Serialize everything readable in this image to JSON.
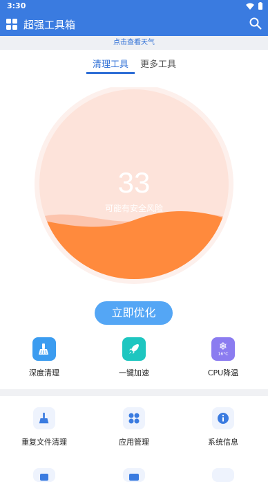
{
  "status_bar": {
    "time": "3:30"
  },
  "app_bar": {
    "title": "超强工具箱"
  },
  "weather_banner": "点击查看天气",
  "tabs": [
    {
      "label": "清理工具",
      "active": true
    },
    {
      "label": "更多工具",
      "active": false
    }
  ],
  "gauge": {
    "score": "33",
    "status": "可能有安全风险",
    "fill_level": 0.3
  },
  "optimize_button": "立即优化",
  "quick_actions": [
    {
      "label": "深度清理",
      "icon": "broom-icon",
      "color": "#3b9cf0"
    },
    {
      "label": "一键加速",
      "icon": "rocket-icon",
      "color": "#1ec6c0"
    },
    {
      "label": "CPU降温",
      "icon": "snowflake-icon",
      "color": "#8b7cf0",
      "badge": "16°C"
    }
  ],
  "tools": [
    {
      "label": "重复文件清理",
      "icon": "broom-icon"
    },
    {
      "label": "应用管理",
      "icon": "apps-icon"
    },
    {
      "label": "系统信息",
      "icon": "info-icon"
    }
  ],
  "colors": {
    "primary": "#3a7be0",
    "gauge_fill": "#ff8a3d",
    "gauge_bg": "#fde3da"
  }
}
